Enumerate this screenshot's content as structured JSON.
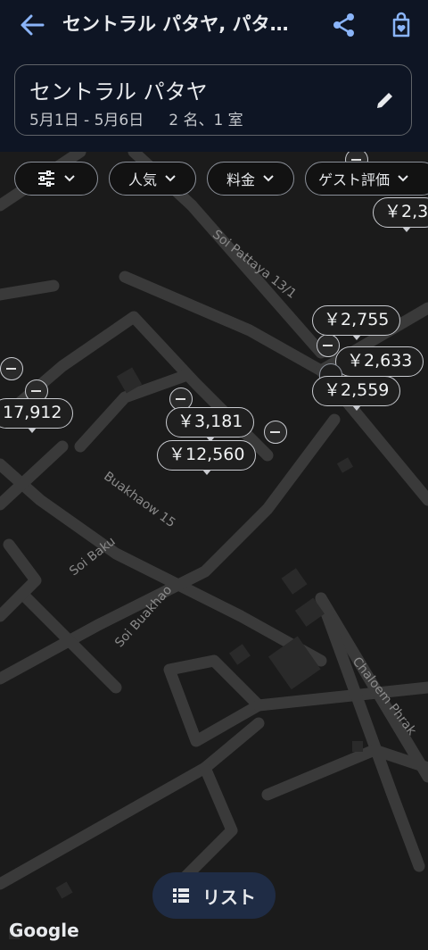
{
  "header": {
    "title": "セントラル パタヤ, パタ…",
    "back_icon": "arrow-back-icon",
    "share_icon": "share-icon",
    "save_icon": "bag-heart-icon"
  },
  "search": {
    "location": "セントラル パタヤ",
    "dates": "5月1日 - 5月6日",
    "guests": "2 名、1 室",
    "edit_icon": "pencil-icon"
  },
  "filters": {
    "settings_icon": "tune-icon",
    "popular": "人気",
    "price": "料金",
    "rating": "ゲスト評価"
  },
  "map": {
    "streets": [
      "Soi Pattaya 13/1",
      "Buakhaow 15",
      "Soi Baku",
      "Soi Buakhao",
      "Chaloem Phrak"
    ],
    "prices": [
      "￥2,3",
      "￥2,755",
      "￥2,633",
      "￥2,559",
      "17,912",
      "￥3,181",
      "￥12,560"
    ]
  },
  "list_button": {
    "label": "リスト",
    "icon": "list-icon"
  },
  "attribution": "Google",
  "colors": {
    "accent": "#8ab4f8",
    "topbar": "#0e1524",
    "map_bg": "#1b1b1b",
    "road": "#3a3a3a"
  }
}
